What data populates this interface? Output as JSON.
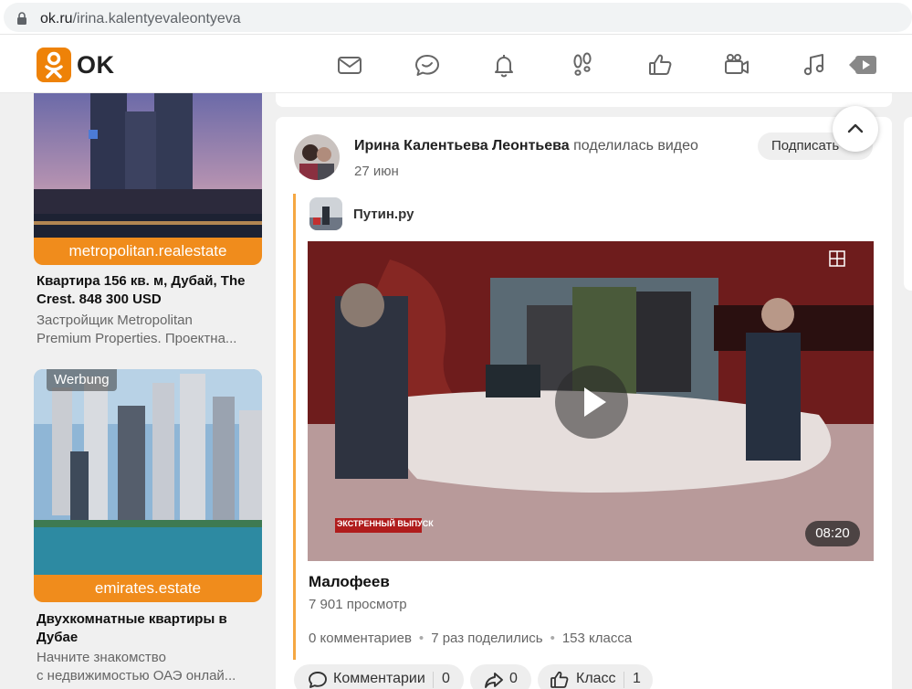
{
  "browser": {
    "url_domain": "ok.ru",
    "url_path": "/irina.kalentyevaleontyeva"
  },
  "topnav": {
    "logo_text": "OK",
    "icons": [
      "mail-icon",
      "chat-icon",
      "bell-icon",
      "footprints-icon",
      "like-icon",
      "camera-icon",
      "music-icon",
      "video-icon"
    ],
    "accent": "#ee8208"
  },
  "ads": [
    {
      "site": "metropolitan.realestate",
      "title": "Квартира 156 кв. м, Дубай, The Crest. 848 300 USD",
      "desc_line1": "Застройщик Metropolitan",
      "desc_line2": "Premium Properties. Проектна..."
    },
    {
      "badge": "Werbung",
      "site": "emirates.estate",
      "title": "Двухкомнатные квартиры в Дубае",
      "desc_line1": "Начните знакомство",
      "desc_line2": "с недвижимостью ОАЭ онлай..."
    }
  ],
  "post": {
    "author_name": "Ирина Калентьева Леонтьева",
    "author_action": "поделилась видео",
    "date": "27 июн",
    "subscribe_label": "Подписать",
    "group_name": "Путин.ру",
    "video_duration": "08:20",
    "video_badge": "ЭКСТРЕННЫЙ ВЫПУСК",
    "video_title": "Малофеев",
    "views": "7 901 просмотр",
    "comments_stat": "0 комментариев",
    "shares_stat": "7 раз поделились",
    "likes_stat": "153 класса"
  },
  "actions": {
    "comments_label": "Комментарии",
    "comments_count": "0",
    "share_count": "0",
    "like_label": "Класс",
    "like_count": "1"
  }
}
